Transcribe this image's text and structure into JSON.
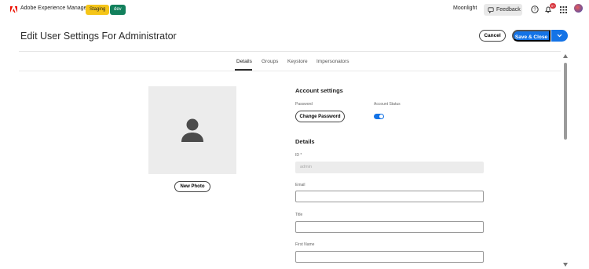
{
  "topbar": {
    "app_title": "Adobe Experience Manager",
    "badge_staging": "Staging",
    "badge_dev": "dev",
    "org": "Moonlight",
    "feedback": "Feedback",
    "notification_count": "9+",
    "colors": {
      "accent": "#1473e6",
      "staging": "#f5c518",
      "dev": "#12805c",
      "adobe_red": "#eb1000"
    }
  },
  "header": {
    "title": "Edit User Settings For Administrator",
    "cancel_label": "Cancel",
    "save_label": "Save & Close"
  },
  "tabs": [
    "Details",
    "Groups",
    "Keystore",
    "Impersonators"
  ],
  "photo": {
    "button_label": "New Photo",
    "icon": "user-silhouette-icon"
  },
  "account": {
    "heading": "Account settings",
    "password_label": "Password",
    "change_password_label": "Change Password",
    "status_label": "Account Status",
    "status_enabled": true
  },
  "details": {
    "heading": "Details",
    "id_label": "ID *",
    "id_value": "admin",
    "email_label": "Email",
    "email_value": "",
    "title_label": "Title",
    "title_value": "",
    "first_name_label": "First Name",
    "first_name_value": ""
  }
}
